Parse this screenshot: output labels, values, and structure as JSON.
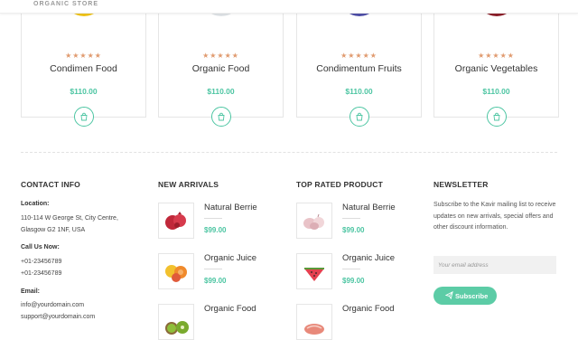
{
  "header": {
    "brand": "ORGANIC STORE"
  },
  "products": [
    {
      "name": "Condimen Food",
      "price": "$110.00",
      "rating": "★★★★★",
      "image_color": "#f0c419"
    },
    {
      "name": "Organic Food",
      "price": "$110.00",
      "rating": "★★★★★",
      "image_color": "#dfe3e6"
    },
    {
      "name": "Condimentum Fruits",
      "price": "$110.00",
      "rating": "★★★★★",
      "image_color": "#4f4fa8"
    },
    {
      "name": "Organic Vegetables",
      "price": "$110.00",
      "rating": "★★★★★",
      "image_color": "#8c1f2a"
    }
  ],
  "contact": {
    "heading": "CONTACT INFO",
    "location_label": "Location:",
    "address_line1": "110-114 W George St, City Centre,",
    "address_line2": "Glasgow G2 1NF, USA",
    "call_label": "Call Us Now:",
    "phone1": "+01-23456789",
    "phone2": "+01-23456789",
    "email_label": "Email:",
    "email1": "info@yourdomain.com",
    "email2": "support@yourdomain.com"
  },
  "new_arrivals": {
    "heading": "NEW ARRIVALS",
    "items": [
      {
        "name": "Natural Berrie",
        "price": "$99.00",
        "icon": "pomegranate-icon"
      },
      {
        "name": "Organic Juice",
        "price": "$99.00",
        "icon": "citrus-fruits-icon"
      },
      {
        "name": "Organic Food",
        "price": "",
        "icon": "kiwi-icon"
      }
    ]
  },
  "top_rated": {
    "heading": "TOP RATED PRODUCT",
    "items": [
      {
        "name": "Natural Berrie",
        "price": "$99.00",
        "icon": "garlic-icon"
      },
      {
        "name": "Organic Juice",
        "price": "$99.00",
        "icon": "watermelon-icon"
      },
      {
        "name": "Organic Food",
        "price": "",
        "icon": "meat-icon"
      }
    ]
  },
  "newsletter": {
    "heading": "NEWSLETTER",
    "text": "Subscribe to the Kavir mailing list to receive updates on new arrivals, special offers and other discount information.",
    "email_placeholder": "Your email address",
    "button_label": "Subscribe"
  },
  "colors": {
    "accent": "#4cc5a2",
    "star": "#e09a6e",
    "button": "#5ccca6"
  }
}
